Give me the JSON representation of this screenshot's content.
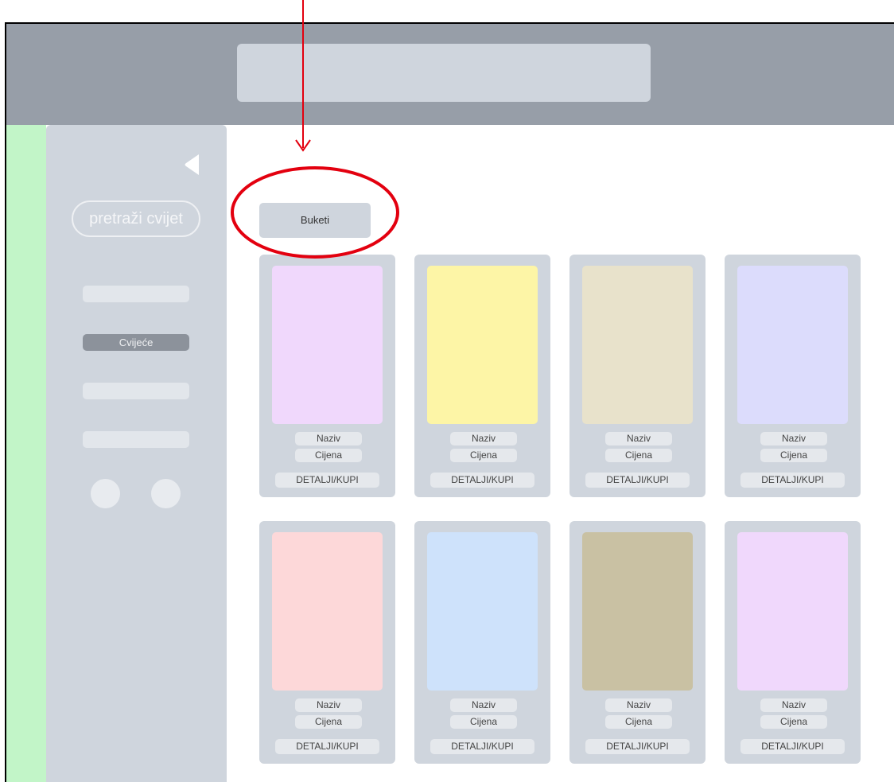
{
  "sidebar": {
    "search_label": "pretraži cvijet",
    "items": [
      {
        "label": ""
      },
      {
        "label": "Cvijeće"
      },
      {
        "label": ""
      },
      {
        "label": ""
      }
    ]
  },
  "category_button": "Buketi",
  "products": [
    {
      "name": "Naziv",
      "price": "Cijena",
      "action": "DETALJI/KUPI",
      "color": "#f0d8fc"
    },
    {
      "name": "Naziv",
      "price": "Cijena",
      "action": "DETALJI/KUPI",
      "color": "#fdf5a6"
    },
    {
      "name": "Naziv",
      "price": "Cijena",
      "action": "DETALJI/KUPI",
      "color": "#e8e2cb"
    },
    {
      "name": "Naziv",
      "price": "Cijena",
      "action": "DETALJI/KUPI",
      "color": "#dcdcfc"
    },
    {
      "name": "Naziv",
      "price": "Cijena",
      "action": "DETALJI/KUPI",
      "color": "#fdd8d9"
    },
    {
      "name": "Naziv",
      "price": "Cijena",
      "action": "DETALJI/KUPI",
      "color": "#cee2fb"
    },
    {
      "name": "Naziv",
      "price": "Cijena",
      "action": "DETALJI/KUPI",
      "color": "#c9c1a3"
    },
    {
      "name": "Naziv",
      "price": "Cijena",
      "action": "DETALJI/KUPI",
      "color": "#f0d8fc"
    }
  ],
  "colors": {
    "topbar": "#979ea8",
    "panel": "#cfd5dd",
    "green_strip": "#c2f5c8",
    "annotation": "#e3000f"
  }
}
